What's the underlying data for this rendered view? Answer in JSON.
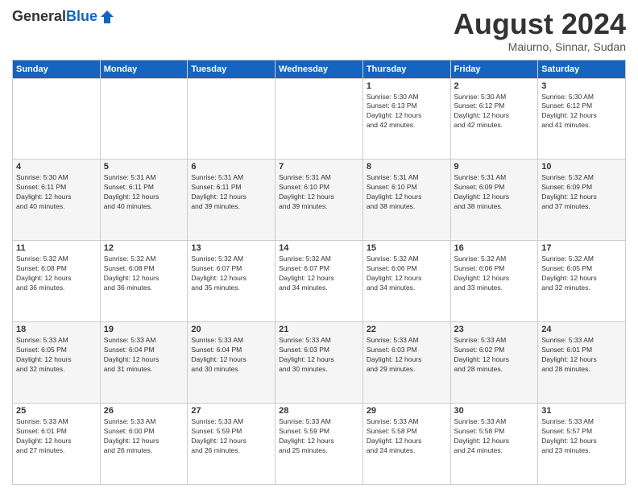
{
  "header": {
    "logo_general": "General",
    "logo_blue": "Blue",
    "month_title": "August 2024",
    "location": "Maiurno, Sinnar, Sudan"
  },
  "weekdays": [
    "Sunday",
    "Monday",
    "Tuesday",
    "Wednesday",
    "Thursday",
    "Friday",
    "Saturday"
  ],
  "weeks": [
    [
      {
        "day": "",
        "info": ""
      },
      {
        "day": "",
        "info": ""
      },
      {
        "day": "",
        "info": ""
      },
      {
        "day": "",
        "info": ""
      },
      {
        "day": "1",
        "info": "Sunrise: 5:30 AM\nSunset: 6:13 PM\nDaylight: 12 hours\nand 42 minutes."
      },
      {
        "day": "2",
        "info": "Sunrise: 5:30 AM\nSunset: 6:12 PM\nDaylight: 12 hours\nand 42 minutes."
      },
      {
        "day": "3",
        "info": "Sunrise: 5:30 AM\nSunset: 6:12 PM\nDaylight: 12 hours\nand 41 minutes."
      }
    ],
    [
      {
        "day": "4",
        "info": "Sunrise: 5:30 AM\nSunset: 6:11 PM\nDaylight: 12 hours\nand 40 minutes."
      },
      {
        "day": "5",
        "info": "Sunrise: 5:31 AM\nSunset: 6:11 PM\nDaylight: 12 hours\nand 40 minutes."
      },
      {
        "day": "6",
        "info": "Sunrise: 5:31 AM\nSunset: 6:11 PM\nDaylight: 12 hours\nand 39 minutes."
      },
      {
        "day": "7",
        "info": "Sunrise: 5:31 AM\nSunset: 6:10 PM\nDaylight: 12 hours\nand 39 minutes."
      },
      {
        "day": "8",
        "info": "Sunrise: 5:31 AM\nSunset: 6:10 PM\nDaylight: 12 hours\nand 38 minutes."
      },
      {
        "day": "9",
        "info": "Sunrise: 5:31 AM\nSunset: 6:09 PM\nDaylight: 12 hours\nand 38 minutes."
      },
      {
        "day": "10",
        "info": "Sunrise: 5:32 AM\nSunset: 6:09 PM\nDaylight: 12 hours\nand 37 minutes."
      }
    ],
    [
      {
        "day": "11",
        "info": "Sunrise: 5:32 AM\nSunset: 6:08 PM\nDaylight: 12 hours\nand 36 minutes."
      },
      {
        "day": "12",
        "info": "Sunrise: 5:32 AM\nSunset: 6:08 PM\nDaylight: 12 hours\nand 36 minutes."
      },
      {
        "day": "13",
        "info": "Sunrise: 5:32 AM\nSunset: 6:07 PM\nDaylight: 12 hours\nand 35 minutes."
      },
      {
        "day": "14",
        "info": "Sunrise: 5:32 AM\nSunset: 6:07 PM\nDaylight: 12 hours\nand 34 minutes."
      },
      {
        "day": "15",
        "info": "Sunrise: 5:32 AM\nSunset: 6:06 PM\nDaylight: 12 hours\nand 34 minutes."
      },
      {
        "day": "16",
        "info": "Sunrise: 5:32 AM\nSunset: 6:06 PM\nDaylight: 12 hours\nand 33 minutes."
      },
      {
        "day": "17",
        "info": "Sunrise: 5:32 AM\nSunset: 6:05 PM\nDaylight: 12 hours\nand 32 minutes."
      }
    ],
    [
      {
        "day": "18",
        "info": "Sunrise: 5:33 AM\nSunset: 6:05 PM\nDaylight: 12 hours\nand 32 minutes."
      },
      {
        "day": "19",
        "info": "Sunrise: 5:33 AM\nSunset: 6:04 PM\nDaylight: 12 hours\nand 31 minutes."
      },
      {
        "day": "20",
        "info": "Sunrise: 5:33 AM\nSunset: 6:04 PM\nDaylight: 12 hours\nand 30 minutes."
      },
      {
        "day": "21",
        "info": "Sunrise: 5:33 AM\nSunset: 6:03 PM\nDaylight: 12 hours\nand 30 minutes."
      },
      {
        "day": "22",
        "info": "Sunrise: 5:33 AM\nSunset: 6:03 PM\nDaylight: 12 hours\nand 29 minutes."
      },
      {
        "day": "23",
        "info": "Sunrise: 5:33 AM\nSunset: 6:02 PM\nDaylight: 12 hours\nand 28 minutes."
      },
      {
        "day": "24",
        "info": "Sunrise: 5:33 AM\nSunset: 6:01 PM\nDaylight: 12 hours\nand 28 minutes."
      }
    ],
    [
      {
        "day": "25",
        "info": "Sunrise: 5:33 AM\nSunset: 6:01 PM\nDaylight: 12 hours\nand 27 minutes."
      },
      {
        "day": "26",
        "info": "Sunrise: 5:33 AM\nSunset: 6:00 PM\nDaylight: 12 hours\nand 26 minutes."
      },
      {
        "day": "27",
        "info": "Sunrise: 5:33 AM\nSunset: 5:59 PM\nDaylight: 12 hours\nand 26 minutes."
      },
      {
        "day": "28",
        "info": "Sunrise: 5:33 AM\nSunset: 5:59 PM\nDaylight: 12 hours\nand 25 minutes."
      },
      {
        "day": "29",
        "info": "Sunrise: 5:33 AM\nSunset: 5:58 PM\nDaylight: 12 hours\nand 24 minutes."
      },
      {
        "day": "30",
        "info": "Sunrise: 5:33 AM\nSunset: 5:58 PM\nDaylight: 12 hours\nand 24 minutes."
      },
      {
        "day": "31",
        "info": "Sunrise: 5:33 AM\nSunset: 5:57 PM\nDaylight: 12 hours\nand 23 minutes."
      }
    ]
  ]
}
